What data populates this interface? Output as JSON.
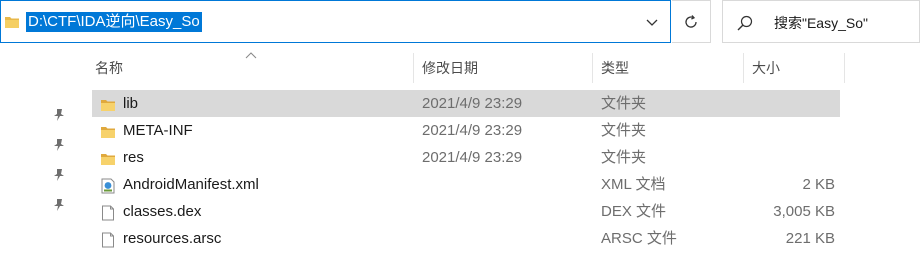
{
  "address": {
    "path": "D:\\CTF\\IDA逆向\\Easy_So"
  },
  "search": {
    "placeholder": "搜索\"Easy_So\""
  },
  "columns": {
    "name": "名称",
    "date": "修改日期",
    "type": "类型",
    "size": "大小"
  },
  "files": [
    {
      "icon": "folder-icon",
      "name": "lib",
      "date": "2021/4/9 23:29",
      "type": "文件夹",
      "size": "",
      "selected": true
    },
    {
      "icon": "folder-icon",
      "name": "META-INF",
      "date": "2021/4/9 23:29",
      "type": "文件夹",
      "size": ""
    },
    {
      "icon": "folder-icon",
      "name": "res",
      "date": "2021/4/9 23:29",
      "type": "文件夹",
      "size": ""
    },
    {
      "icon": "xml-file-icon",
      "name": "AndroidManifest.xml",
      "date": "",
      "type": "XML 文档",
      "size": "2 KB"
    },
    {
      "icon": "file-icon",
      "name": "classes.dex",
      "date": "",
      "type": "DEX 文件",
      "size": "3,005 KB"
    },
    {
      "icon": "file-icon",
      "name": "resources.arsc",
      "date": "",
      "type": "ARSC 文件",
      "size": "221 KB"
    }
  ],
  "colors": {
    "accent": "#0078d7",
    "selected_row": "#d9d9d9",
    "folder": "#e8b84a"
  }
}
